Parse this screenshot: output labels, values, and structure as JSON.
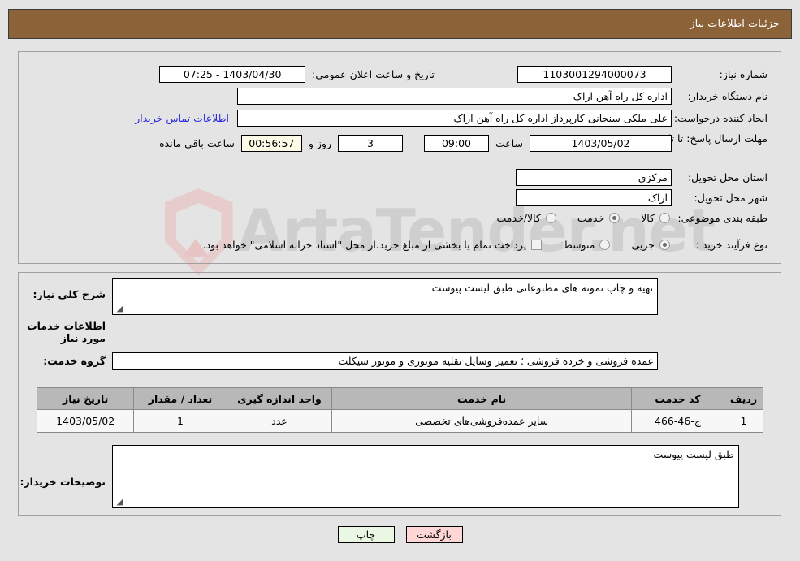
{
  "window": {
    "title": "جزئیات اطلاعات نیاز",
    "header_bg": "#8c6239",
    "page_bg": "#e4e4e4"
  },
  "watermark": {
    "text": "ArtaTender.net",
    "shield_color": "#e8c4c4",
    "text_color": "#cfcfcf"
  },
  "top_panel": {
    "need_number": {
      "label": "شماره نیاز:",
      "value": "1103001294000073"
    },
    "announce_datetime": {
      "label": "تاریخ و ساعت اعلان عمومی:",
      "value": "1403/04/30 - 07:25"
    },
    "buyer_org": {
      "label": "نام دستگاه خریدار:",
      "value": "اداره کل راه آهن اراک"
    },
    "request_creator": {
      "label": "ایجاد کننده درخواست:",
      "value": "علی ملکی سنجانی کارپرداز اداره کل راه آهن اراک"
    },
    "buyer_contact_link": "اطلاعات تماس خریدار",
    "deadline": {
      "label": "مهلت ارسال پاسخ: تا تاریخ:",
      "date": "1403/05/02",
      "time_label": "ساعت",
      "time": "09:00",
      "days": "3",
      "days_label": "روز و",
      "countdown": "00:56:57",
      "countdown_label": "ساعت باقی مانده"
    },
    "delivery_province": {
      "label": "استان محل تحویل:",
      "value": "مرکزی"
    },
    "delivery_city": {
      "label": "شهر محل تحویل:",
      "value": "اراک"
    },
    "subject_category": {
      "label": "طبقه بندی موضوعی:",
      "options": [
        {
          "label": "کالا",
          "selected": false
        },
        {
          "label": "خدمت",
          "selected": true
        },
        {
          "label": "کالا/خدمت",
          "selected": false
        }
      ]
    },
    "purchase_process": {
      "label": "نوع فرآیند خرید :",
      "options": [
        {
          "label": "جزیی",
          "selected": true
        },
        {
          "label": "متوسط",
          "selected": false
        }
      ],
      "treasury_checkbox": {
        "checked": false,
        "text": "پرداخت تمام یا بخشی از مبلغ خرید،از محل \"اسناد خزانه اسلامی\" خواهد بود."
      }
    }
  },
  "bottom_panel": {
    "general_description": {
      "label": "شرح کلی نیاز:",
      "value": "تهیه و چاپ نمونه های مطبوعاتی طبق لیست پیوست"
    },
    "services_heading": "اطلاعات خدمات مورد نیاز",
    "service_group": {
      "label": "گروه خدمت:",
      "value": "عمده فروشی و خرده فروشی ؛ تعمیر وسایل نقلیه موتوری و موتور سیکلت"
    },
    "items_table": {
      "columns": [
        "ردیف",
        "کد خدمت",
        "نام خدمت",
        "واحد اندازه گیری",
        "تعداد / مقدار",
        "تاریخ نیاز"
      ],
      "rows": [
        {
          "row_no": "1",
          "service_code": "ج-46-466",
          "service_name": "سایر عمده‌فروشی‌های تخصصی",
          "unit": "عدد",
          "quantity": "1",
          "need_date": "1403/05/02"
        }
      ]
    },
    "buyer_notes": {
      "label": "توضیحات خریدار:",
      "value": "طبق لیست پیوست"
    }
  },
  "footer": {
    "print_button": "چاپ",
    "back_button": "بازگشت"
  }
}
